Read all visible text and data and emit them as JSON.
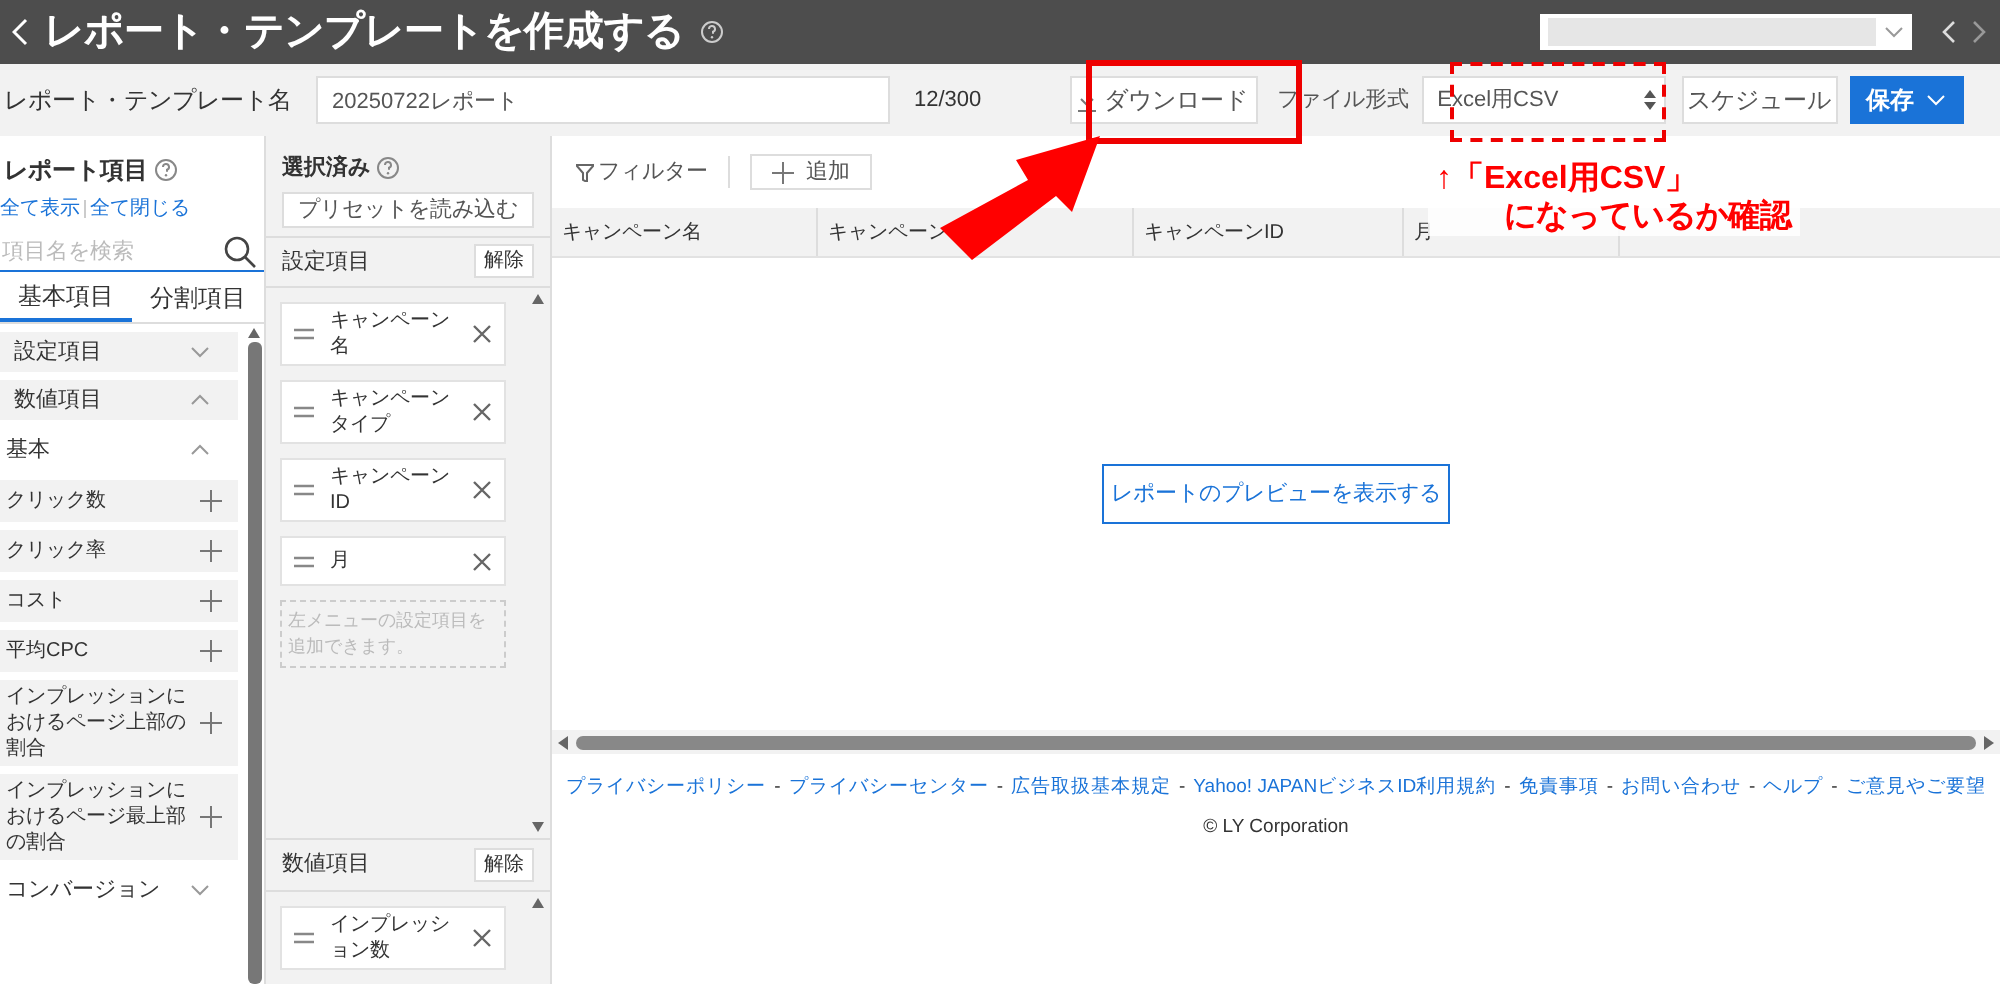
{
  "header": {
    "title": "レポート・テンプレートを作成する"
  },
  "name_row": {
    "label": "レポート・テンプレート名",
    "value": "20250722レポート",
    "count": "12/300",
    "download": "ダウンロード",
    "format_label": "ファイル形式",
    "format_value": "Excel用CSV",
    "schedule": "スケジュール",
    "save": "保存"
  },
  "report_items": {
    "title": "レポート項目",
    "show_all": "全て表示",
    "close_all": "全て閉じる",
    "search_placeholder": "項目名を検索",
    "tabs": [
      {
        "label": "基本項目",
        "selected": true
      },
      {
        "label": "分割項目",
        "selected": false
      }
    ],
    "items": [
      {
        "kind": "section",
        "label": "設定項目",
        "expanded": false
      },
      {
        "kind": "section",
        "label": "数値項目",
        "expanded": true
      },
      {
        "kind": "group",
        "label": "基本",
        "expanded": true
      },
      {
        "kind": "item",
        "label": "クリック数"
      },
      {
        "kind": "item",
        "label": "クリック率"
      },
      {
        "kind": "item",
        "label": "コスト"
      },
      {
        "kind": "item",
        "label": "平均CPC"
      },
      {
        "kind": "item",
        "label": "インプレッションにおけるページ上部の割合"
      },
      {
        "kind": "item",
        "label": "インプレッションにおけるページ最上部の割合"
      },
      {
        "kind": "group",
        "label": "コンバージョン",
        "expanded": false
      }
    ]
  },
  "selected": {
    "title": "選択済み",
    "preset": "プリセットを読み込む",
    "sections": [
      {
        "title": "設定項目",
        "clear": "解除",
        "chips": [
          "キャンペーン名",
          "キャンペーンタイプ",
          "キャンペーンID",
          "月"
        ],
        "hint": "左メニューの設定項目を追加できます。"
      },
      {
        "title": "数値項目",
        "clear": "解除",
        "chips": [
          "インプレッション数"
        ]
      }
    ]
  },
  "preview": {
    "filter": "フィルター",
    "add": "追加",
    "columns": [
      "キャンペーン名",
      "キャンペーン",
      "キャンペーンID",
      "月"
    ],
    "show_preview": "レポートのプレビューを表示する"
  },
  "footer": {
    "links": [
      "プライバシーポリシー",
      "プライバシーセンター",
      "広告取扱基本規定",
      "Yahoo! JAPANビジネスID利用規約",
      "免責事項",
      "お問い合わせ",
      "ヘルプ",
      "ご意見やご要望"
    ],
    "separator": "-",
    "copyright": "© LY Corporation"
  },
  "annotation": {
    "line1": "↑「Excel用CSV」",
    "line2": "になっているか確認"
  }
}
